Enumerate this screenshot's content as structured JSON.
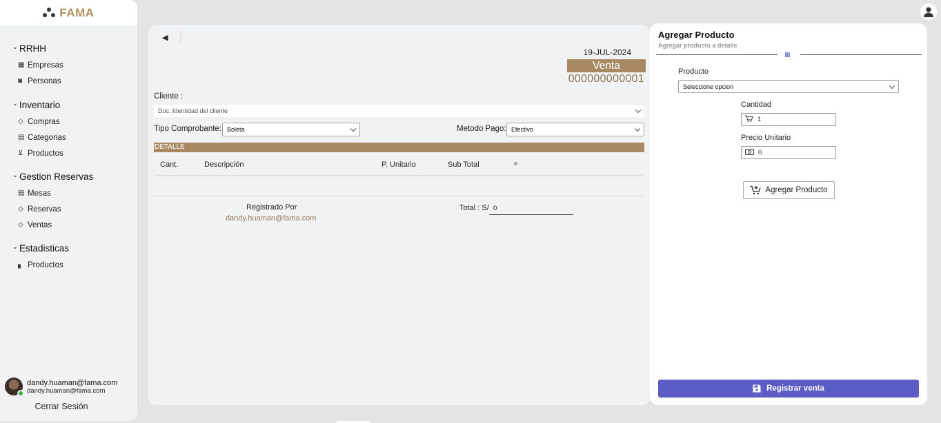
{
  "brand": {
    "name": "FAMA"
  },
  "sidebar": {
    "groups": [
      {
        "title": "RRHH",
        "items": [
          {
            "label": "Empresas",
            "icon": "building-icon"
          },
          {
            "label": "Personas",
            "icon": "person-card-icon"
          }
        ]
      },
      {
        "title": "Inventario",
        "items": [
          {
            "label": "Compras",
            "icon": "tag-icon"
          },
          {
            "label": "Categorias",
            "icon": "boxes-icon"
          },
          {
            "label": "Productos",
            "icon": "cart-icon"
          }
        ]
      },
      {
        "title": "Gestion Reservas",
        "items": [
          {
            "label": "Mesas",
            "icon": "boxes-icon"
          },
          {
            "label": "Reservas",
            "icon": "tag-icon"
          },
          {
            "label": "Ventas",
            "icon": "tag-icon"
          }
        ]
      },
      {
        "title": "Estadisticas",
        "items": [
          {
            "label": "Productos",
            "icon": "bar-chart-icon"
          }
        ]
      }
    ],
    "user": {
      "email": "dandy.huaman@fama.com",
      "email_secondary": "dandy.huaman@fama.com",
      "status": "online"
    },
    "logout_label": "Cerrar Sesión"
  },
  "sale": {
    "date": "19-JUL-2024",
    "doc_type": "Venta",
    "doc_number": "000000000001",
    "cliente_label": "Cliente :",
    "cliente_placeholder": "Doc. Identidad del cliente",
    "tipo_comprobante_label": "Tipo Comprobante:",
    "tipo_comprobante_value": "Boleta",
    "metodo_pago_label": "Metodo Pago:",
    "metodo_pago_value": "Efectivo",
    "detalle_label": "DETALLE",
    "columns": [
      "Cant.",
      "Descripción",
      "P. Unitario",
      "Sub Total"
    ],
    "registrado_label": "Registrado Por",
    "registrado_email": "dandy.huaman@fama.com",
    "total_label": "Total : S/",
    "total_value": "0"
  },
  "add_product": {
    "title": "Agregar Producto",
    "subtitle": "Agregar producto a detalle",
    "producto_label": "Producto",
    "producto_placeholder": "Seleccione opcion",
    "cantidad_label": "Cantidad",
    "cantidad_value": "1",
    "precio_label": "Precio Unitario",
    "precio_value": "0",
    "add_button": "Agregar Producto",
    "register_button": "Registrar venta"
  },
  "colors": {
    "accent_brown": "#a98964",
    "primary_button": "#5b5cc6",
    "brand": "#b09061"
  }
}
